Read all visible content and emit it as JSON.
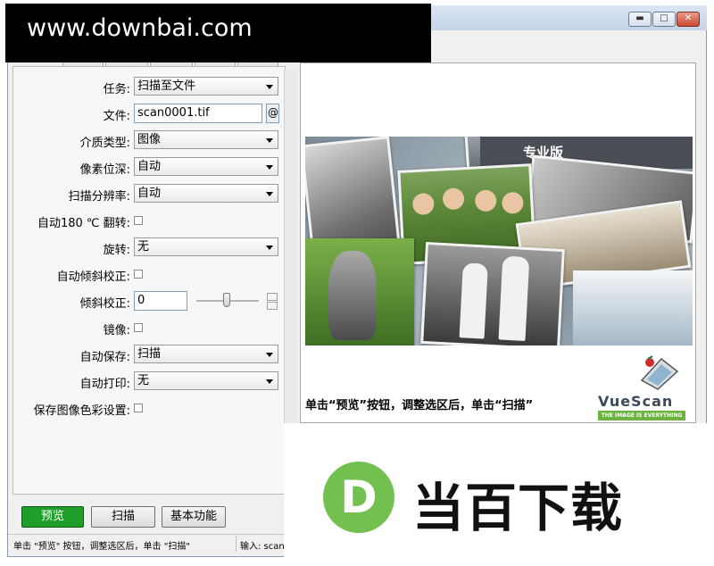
{
  "watermark": {
    "text": "www.downbai.com"
  },
  "window": {
    "controls": {
      "minimize": "▬",
      "maximize": "□",
      "close": "✕"
    }
  },
  "form": {
    "task": {
      "label": "任务:",
      "value": "扫描至文件"
    },
    "file": {
      "label": "文件:",
      "value": "scan0001.tif",
      "at_button": "@"
    },
    "media": {
      "label": "介质类型:",
      "value": "图像"
    },
    "bit_depth": {
      "label": "像素位深:",
      "value": "自动"
    },
    "resolution": {
      "label": "扫描分辨率:",
      "value": "自动"
    },
    "auto_flip": {
      "label": "自动180 ℃ 翻转:"
    },
    "rotate": {
      "label": "旋转:",
      "value": "无"
    },
    "auto_deskew": {
      "label": "自动倾斜校正:"
    },
    "deskew": {
      "label": "倾斜校正:",
      "value": "0"
    },
    "mirror": {
      "label": "镜像:"
    },
    "auto_save": {
      "label": "自动保存:",
      "value": "扫描"
    },
    "auto_print": {
      "label": "自动打印:",
      "value": "无"
    },
    "save_color": {
      "label": "保存图像色彩设置:"
    }
  },
  "buttons": {
    "preview": "预览",
    "scan": "扫描",
    "basic": "基本功能"
  },
  "status": {
    "left": "单击 \"预览\" 按钮，调整选区后，单击 \"扫描\"",
    "right": "输入: scan"
  },
  "preview": {
    "pro_label": "专业版",
    "hint": "单击“预览”按钮，调整选区后，单击“扫描”",
    "brand": "VueScan",
    "brand_tagline": "THE IMAGE IS EVERYTHING"
  },
  "logo": {
    "letter": "D",
    "text": "当百下载"
  },
  "colors": {
    "accent_green": "#1f9e2a",
    "logo_green": "#72c150"
  }
}
